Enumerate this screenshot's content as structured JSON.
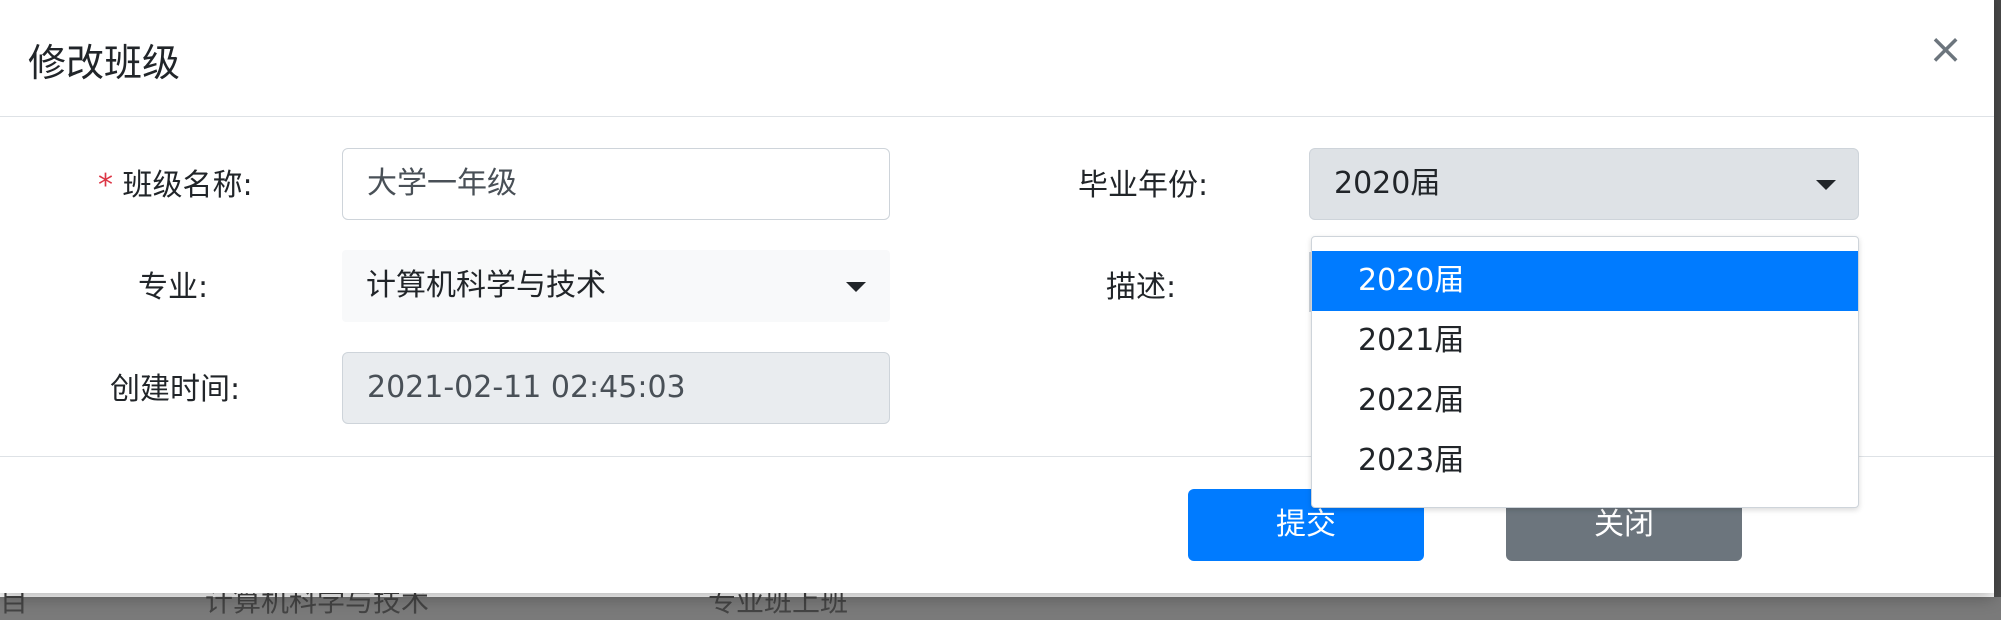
{
  "modal": {
    "title": "修改班级",
    "close_glyph": "×"
  },
  "form": {
    "class_name": {
      "required_mark": "*",
      "label": "班级名称:",
      "value": "大学一年级"
    },
    "graduation_year": {
      "label": "毕业年份:",
      "selected": "2020届",
      "options": [
        "2020届",
        "2021届",
        "2022届",
        "2023届"
      ],
      "highlighted_index": 0
    },
    "major": {
      "label": "专业:",
      "selected": "计算机科学与技术"
    },
    "description": {
      "label": "描述:"
    },
    "created_time": {
      "label": "创建时间:",
      "value": "2021-02-11 02:45:03"
    }
  },
  "footer": {
    "submit_label": "提交",
    "close_label": "关闭"
  },
  "background_partial_text": {
    "left_text": "计算机科学与技术",
    "right_text": "专业班上班",
    "edge_text": "目"
  },
  "colors": {
    "primary": "#007bff",
    "secondary": "#6c757d",
    "danger": "#dc3545"
  }
}
